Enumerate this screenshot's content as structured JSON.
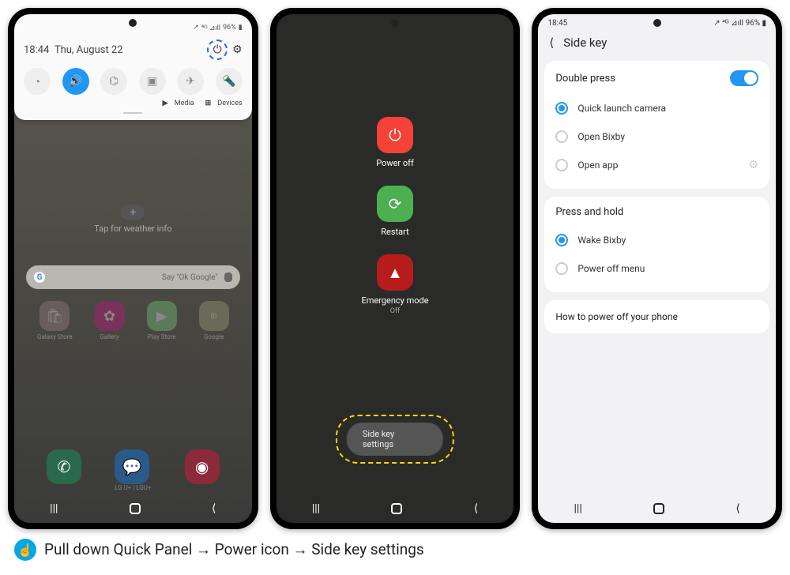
{
  "status": {
    "time": "18:44",
    "date": "Thu, August 22",
    "battery": "96%",
    "signal": "⁴ᴳ ⊿ıll"
  },
  "quickpanel": {
    "media": "Media",
    "devices": "Devices",
    "toggles": [
      "wifi",
      "sound",
      "bluetooth",
      "rotate",
      "airplane",
      "flashlight"
    ]
  },
  "home": {
    "weather": "Tap for weather info",
    "search_placeholder": "Say \"Ok Google\"",
    "apps": [
      {
        "name": "Galaxy Store"
      },
      {
        "name": "Gallery"
      },
      {
        "name": "Play Store"
      },
      {
        "name": "Google"
      }
    ],
    "dock_label": "LG U+ | LGU+"
  },
  "powermenu": {
    "poweroff": "Power off",
    "restart": "Restart",
    "emergency": "Emergency mode",
    "emergency_sub": "Off",
    "sidekey": "Side key settings"
  },
  "sidekey": {
    "status_time": "18:45",
    "title": "Side key",
    "section1": "Double press",
    "opt1": "Quick launch camera",
    "opt2": "Open Bixby",
    "opt3": "Open app",
    "section2": "Press and hold",
    "opt4": "Wake Bixby",
    "opt5": "Power off menu",
    "howto": "How to power off your phone"
  },
  "caption": "Pull down Quick Panel → Power icon → Side key settings"
}
